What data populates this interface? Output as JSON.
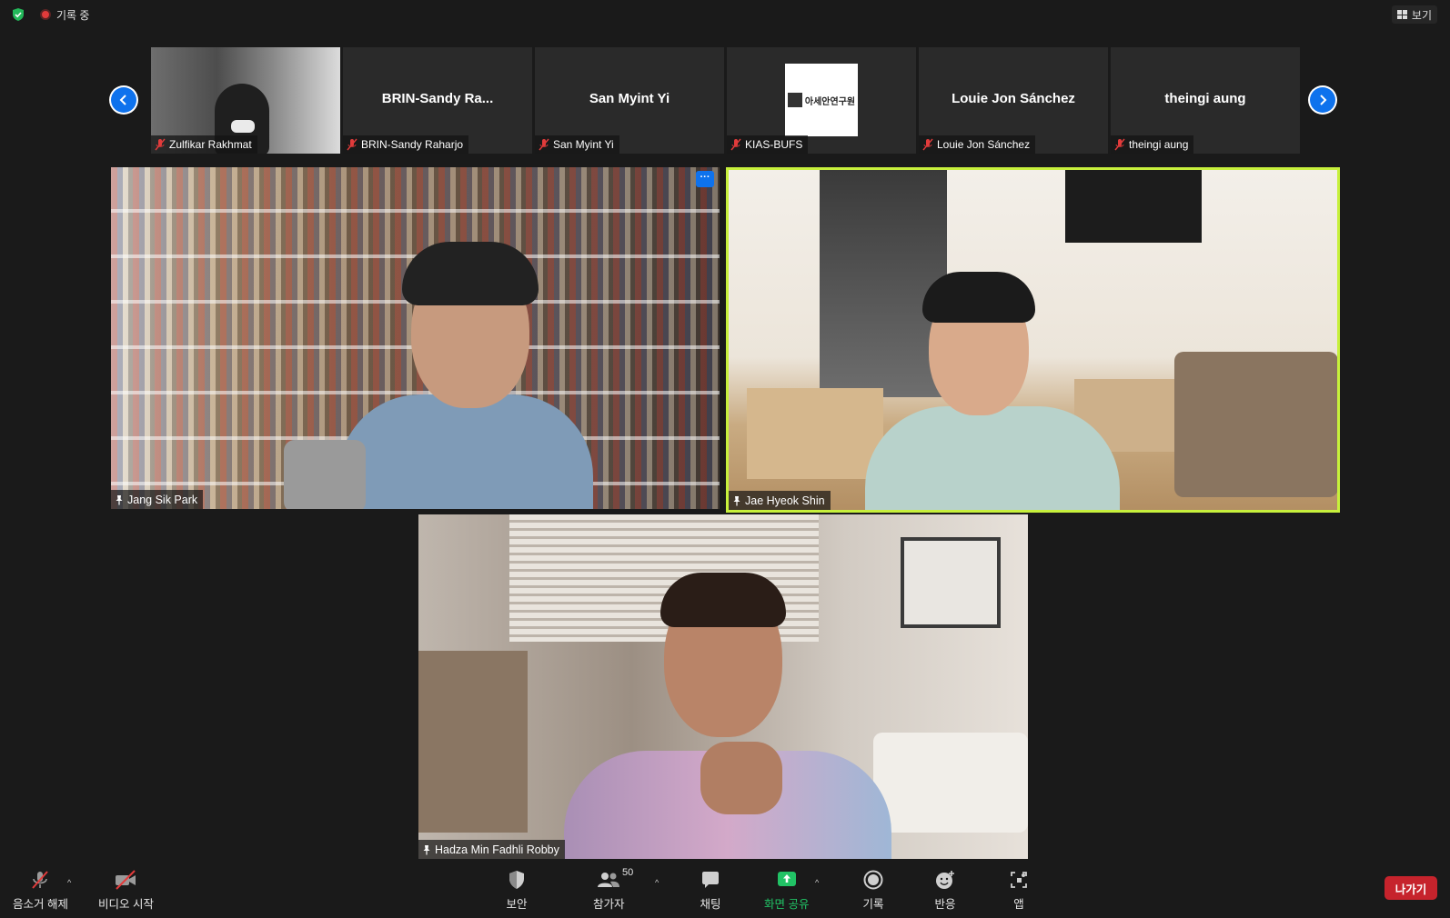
{
  "top_bar": {
    "recording_label": "기록 중",
    "view_label": "보기"
  },
  "thumbnails": [
    {
      "display_name": "Zulfikar Rakhmat",
      "show_video": true
    },
    {
      "display_name": "BRIN-Sandy Raharjo",
      "big_name": "BRIN-Sandy  Ra..."
    },
    {
      "display_name": "San Myint Yi",
      "big_name": "San Myint Yi"
    },
    {
      "display_name": "KIAS-BUFS",
      "logo_text": "아세안연구원",
      "show_logo": true
    },
    {
      "display_name": "Louie Jon Sánchez",
      "big_name": "Louie Jon Sánchez"
    },
    {
      "display_name": "theingi aung",
      "big_name": "theingi aung"
    }
  ],
  "main_tiles": [
    {
      "name": "Jang Sik Park",
      "more_label": "···"
    },
    {
      "name": "Jae Hyeok Shin",
      "active_speaker": true
    },
    {
      "name": "Hadza Min Fadhli Robby"
    }
  ],
  "toolbar": {
    "unmute": "음소거 해제",
    "start_video": "비디오 시작",
    "security": "보안",
    "participants": "참가자",
    "participants_count": "50",
    "chat": "채팅",
    "share_screen": "화면 공유",
    "record": "기록",
    "reactions": "반응",
    "apps": "앱",
    "leave": "나가기"
  },
  "colors": {
    "background": "#1a1a1a",
    "accent_blue": "#0e72ed",
    "active_speaker_border": "#c7f03c",
    "share_green": "#21c265",
    "leave_red": "#c6232c",
    "muted_red": "#e23b3b"
  }
}
